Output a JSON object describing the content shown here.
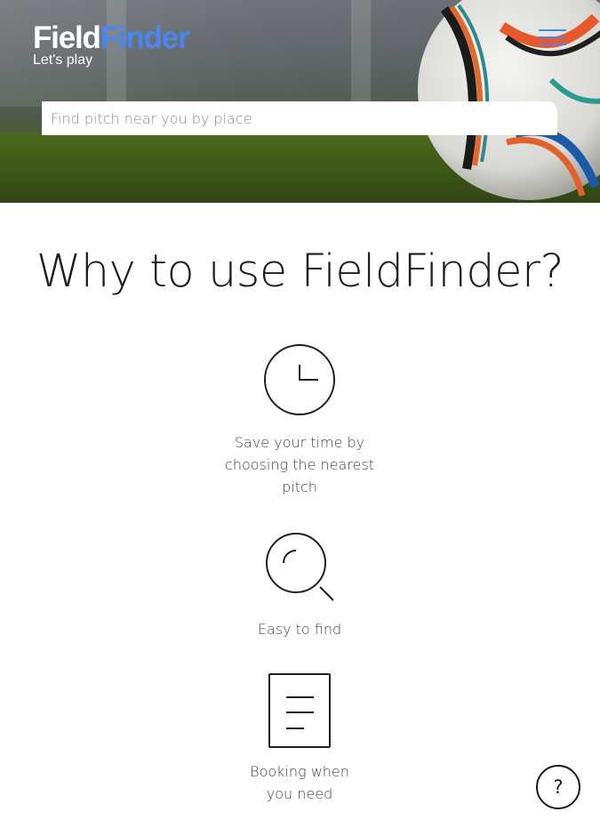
{
  "header": {
    "logo": {
      "part1": "Field",
      "part2": "Finder",
      "tagline": "Let's play"
    },
    "menu_icon": "hamburger-menu-icon",
    "accent_color": "#4a86f0"
  },
  "search": {
    "placeholder": "Find pitch near you by place",
    "value": ""
  },
  "main": {
    "title": "Why to use FieldFinder?",
    "features": [
      {
        "icon": "clock-icon",
        "lines": [
          "Save your time by",
          "choosing the nearest",
          "pitch"
        ]
      },
      {
        "icon": "magnifier-icon",
        "lines": [
          "Easy to find"
        ]
      },
      {
        "icon": "document-icon",
        "lines": [
          "Booking when",
          "you need"
        ]
      }
    ]
  },
  "help_button": {
    "label": "?",
    "icon": "help-icon"
  }
}
